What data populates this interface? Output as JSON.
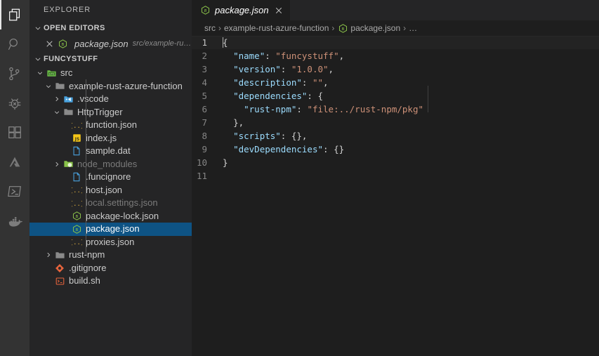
{
  "activitybar": {
    "items": [
      {
        "name": "explorer-icon",
        "label": "Explorer",
        "active": true
      },
      {
        "name": "search-icon",
        "label": "Search",
        "active": false
      },
      {
        "name": "source-control-icon",
        "label": "Source Control",
        "active": false
      },
      {
        "name": "debug-icon",
        "label": "Run and Debug",
        "active": false
      },
      {
        "name": "extensions-icon",
        "label": "Extensions",
        "active": false
      },
      {
        "name": "azure-icon",
        "label": "Azure",
        "active": false
      },
      {
        "name": "powershell-icon",
        "label": "PowerShell",
        "active": false
      },
      {
        "name": "docker-icon",
        "label": "Docker",
        "active": false
      }
    ]
  },
  "sidebar": {
    "title": "EXPLORER",
    "open_editors": {
      "header": "OPEN EDITORS",
      "items": [
        {
          "name": "package.json",
          "description": "src/example-rust-azur...",
          "icon": "npm-icon"
        }
      ]
    },
    "workspace": {
      "header": "FUNCYSTUFF",
      "tree": [
        {
          "label": "src",
          "icon": "folder-src-icon",
          "depth": 0,
          "type": "folder",
          "state": "expanded",
          "dim": false
        },
        {
          "label": "example-rust-azure-function",
          "icon": "folder-icon",
          "depth": 1,
          "type": "folder",
          "state": "expanded",
          "dim": false
        },
        {
          "label": ".vscode",
          "icon": "folder-vscode-icon",
          "depth": 2,
          "type": "folder",
          "state": "collapsed",
          "dim": false
        },
        {
          "label": "HttpTrigger",
          "icon": "folder-icon",
          "depth": 2,
          "type": "folder",
          "state": "expanded",
          "dim": false
        },
        {
          "label": "function.json",
          "icon": "json-icon",
          "depth": 3,
          "type": "file",
          "state": "none",
          "dim": false
        },
        {
          "label": "index.js",
          "icon": "js-icon",
          "depth": 3,
          "type": "file",
          "state": "none",
          "dim": false
        },
        {
          "label": "sample.dat",
          "icon": "document-icon",
          "depth": 3,
          "type": "file",
          "state": "none",
          "dim": false
        },
        {
          "label": "node_modules",
          "icon": "folder-node-icon",
          "depth": 2,
          "type": "folder",
          "state": "collapsed",
          "dim": true
        },
        {
          "label": ".funcignore",
          "icon": "document-icon",
          "depth": 3,
          "type": "file",
          "state": "none",
          "dim": false
        },
        {
          "label": "host.json",
          "icon": "json-icon",
          "depth": 3,
          "type": "file",
          "state": "none",
          "dim": false
        },
        {
          "label": "local.settings.json",
          "icon": "json-icon",
          "depth": 3,
          "type": "file",
          "state": "none",
          "dim": true
        },
        {
          "label": "package-lock.json",
          "icon": "npm-icon",
          "depth": 3,
          "type": "file",
          "state": "none",
          "dim": false
        },
        {
          "label": "package.json",
          "icon": "npm-icon",
          "depth": 3,
          "type": "file",
          "state": "none",
          "dim": false,
          "selected": true
        },
        {
          "label": "proxies.json",
          "icon": "json-icon",
          "depth": 3,
          "type": "file",
          "state": "none",
          "dim": false
        },
        {
          "label": "rust-npm",
          "icon": "folder-icon",
          "depth": 1,
          "type": "folder",
          "state": "collapsed",
          "dim": false
        },
        {
          "label": ".gitignore",
          "icon": "git-icon",
          "depth": 1,
          "type": "file",
          "state": "none",
          "dim": false
        },
        {
          "label": "build.sh",
          "icon": "shell-icon",
          "depth": 1,
          "type": "file",
          "state": "none",
          "dim": false
        }
      ]
    }
  },
  "editor": {
    "tabs": [
      {
        "label": "package.json",
        "icon": "npm-icon",
        "active": true,
        "preview": true,
        "close_glyph": "×"
      }
    ],
    "breadcrumbs": [
      {
        "label": "src",
        "icon": ""
      },
      {
        "label": "example-rust-azure-function",
        "icon": ""
      },
      {
        "label": "package.json",
        "icon": "npm-icon"
      },
      {
        "label": "…",
        "icon": ""
      }
    ],
    "separator": "›",
    "lines": [
      {
        "number": "1",
        "current": true,
        "text": "{"
      },
      {
        "number": "2",
        "current": false,
        "text": "  \"name\": \"funcystuff\","
      },
      {
        "number": "3",
        "current": false,
        "text": "  \"version\": \"1.0.0\","
      },
      {
        "number": "4",
        "current": false,
        "text": "  \"description\": \"\","
      },
      {
        "number": "5",
        "current": false,
        "text": "  \"dependencies\": {"
      },
      {
        "number": "6",
        "current": false,
        "text": "    \"rust-npm\": \"file:../rust-npm/pkg\""
      },
      {
        "number": "7",
        "current": false,
        "text": "  },"
      },
      {
        "number": "8",
        "current": false,
        "text": "  \"scripts\": {},"
      },
      {
        "number": "9",
        "current": false,
        "text": "  \"devDependencies\": {}"
      },
      {
        "number": "10",
        "current": false,
        "text": "}"
      },
      {
        "number": "11",
        "current": false,
        "text": ""
      }
    ]
  },
  "colors": {
    "activitybar_bg": "#333333",
    "sidebar_bg": "#252526",
    "editor_bg": "#1e1e1e",
    "selection_blue": "#0e5384",
    "key_color": "#9cdcfe",
    "string_color": "#ce9178",
    "punct_color": "#d4d4d4",
    "linenumber_color": "#858585"
  }
}
